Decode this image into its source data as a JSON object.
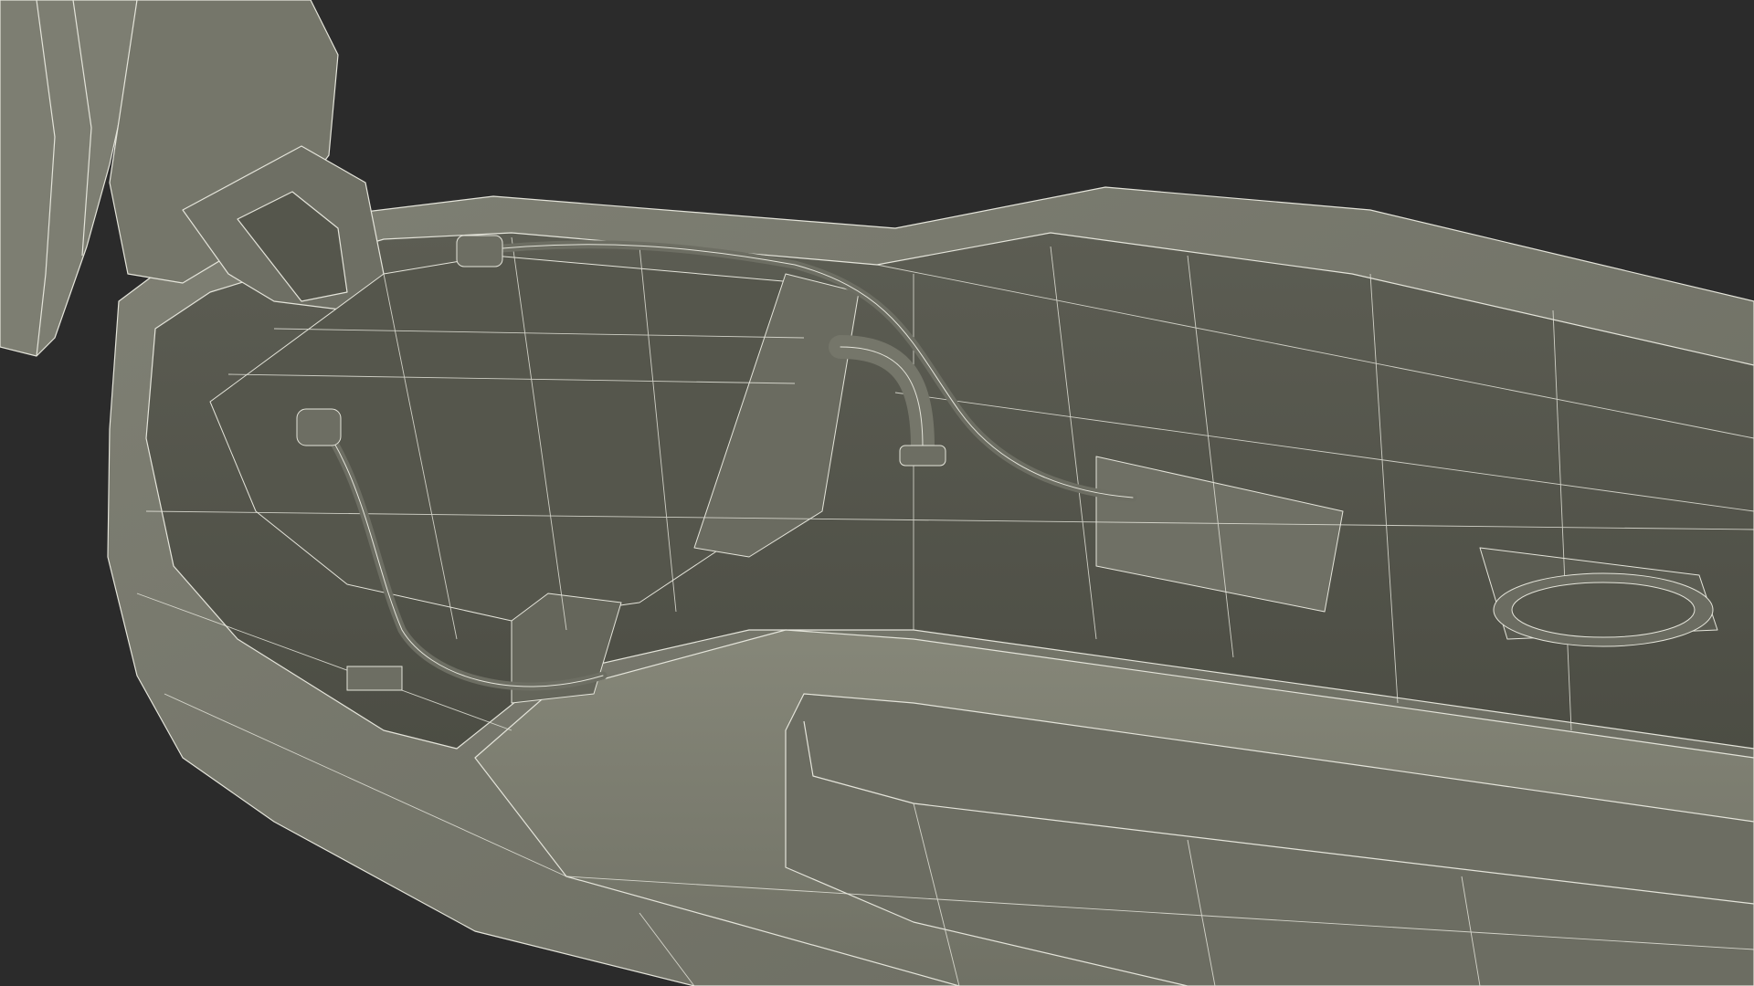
{
  "scene": {
    "subject": "",
    "colors": {
      "background": "#2b2b2b",
      "surface_light": "#7d7e72",
      "surface_mid": "#6c6d62",
      "surface_dark": "#55564c",
      "surface_deep": "#48493f",
      "wire": "#e4e4da"
    }
  }
}
